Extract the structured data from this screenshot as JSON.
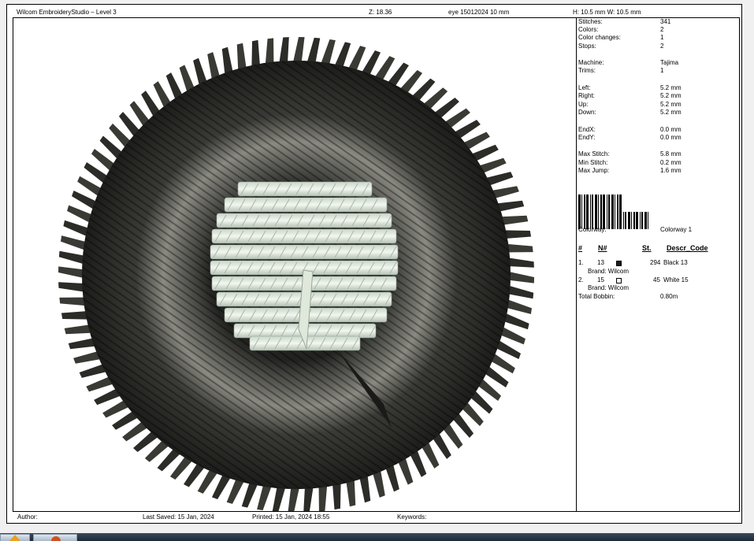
{
  "header": {
    "title": "Wilcom EmbroideryStudio – Level 3",
    "zoom": "Z: 18.36",
    "design": "eye 15012024 10 mm",
    "size": "H: 10.5 mm   W: 10.5 mm"
  },
  "stats": [
    {
      "label": "Stitches:",
      "value": "341"
    },
    {
      "label": "Colors:",
      "value": "2"
    },
    {
      "label": "Color changes:",
      "value": "1"
    },
    {
      "label": "Stops:",
      "value": "2"
    },
    {
      "label": "Machine:",
      "value": "Tajima"
    },
    {
      "label": "Trims:",
      "value": "1"
    },
    {
      "label": "Left:",
      "value": "5.2 mm"
    },
    {
      "label": "Right:",
      "value": "5.2 mm"
    },
    {
      "label": "Up:",
      "value": "5.2 mm"
    },
    {
      "label": "Down:",
      "value": "5.2 mm"
    },
    {
      "label": "EndX:",
      "value": "0.0 mm"
    },
    {
      "label": "EndY:",
      "value": "0.0 mm"
    },
    {
      "label": "Max Stitch:",
      "value": "5.8 mm"
    },
    {
      "label": "Min Stitch:",
      "value": "0.2 mm"
    },
    {
      "label": "Max Jump:",
      "value": "1.6 mm"
    }
  ],
  "colorway": {
    "label": "Colorway:",
    "value": "Colorway 1"
  },
  "table": {
    "headers": {
      "index": "#",
      "n": "N#",
      "st": "St.",
      "descr": "Descr_Code"
    },
    "rows": [
      {
        "index": "1.",
        "n": "13",
        "color": "#1a1a1a",
        "st": "294",
        "descr": "Black 13",
        "brand": "Brand: Wilcom"
      },
      {
        "index": "2.",
        "n": "15",
        "color": "#ffffff",
        "st": "45",
        "descr": "White 15",
        "brand": "Brand: Wilcom"
      }
    ],
    "bobbin_label": "Total Bobbin:",
    "bobbin_value": "0.80m"
  },
  "footer": {
    "author": "Author:",
    "last_saved": "Last Saved: 15 Jan, 2024",
    "printed": "Printed: 15 Jan, 2024 18:55",
    "keywords": "Keywords:"
  }
}
